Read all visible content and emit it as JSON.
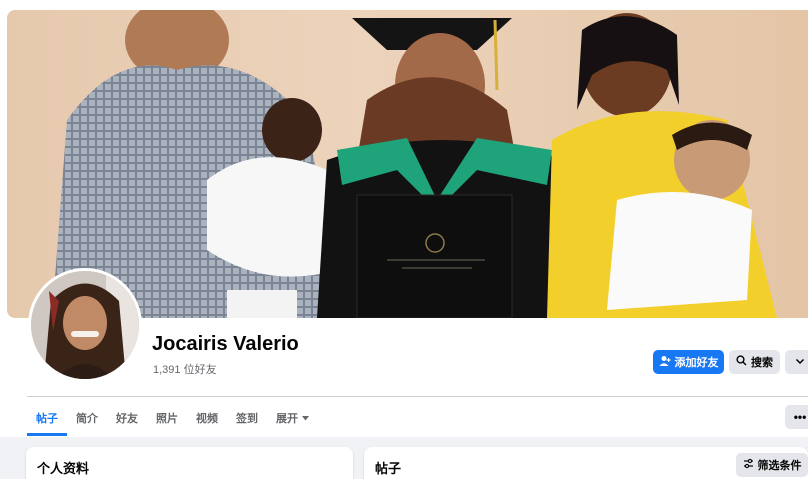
{
  "profile": {
    "name": "Jocairis Valerio",
    "friends_count": "1,391 位好友"
  },
  "actions": {
    "add_friend": "添加好友",
    "search": "搜索"
  },
  "tabs": [
    {
      "label": "帖子",
      "active": true
    },
    {
      "label": "简介",
      "active": false
    },
    {
      "label": "好友",
      "active": false
    },
    {
      "label": "照片",
      "active": false
    },
    {
      "label": "视频",
      "active": false
    },
    {
      "label": "签到",
      "active": false
    },
    {
      "label": "展开",
      "active": false
    }
  ],
  "sections": {
    "intro_title": "个人资料",
    "posts_title": "帖子",
    "filter": "筛选条件"
  },
  "colors": {
    "accent": "#1877f2",
    "secondary_button": "#e4e6eb",
    "background": "#f0f2f5"
  },
  "cover_seal_text": "Universidad Tecnológica de Santiago, UTESA",
  "icons": [
    "add-friend-icon",
    "search-icon",
    "chevron-down-icon",
    "more-icon",
    "filter-icon"
  ]
}
